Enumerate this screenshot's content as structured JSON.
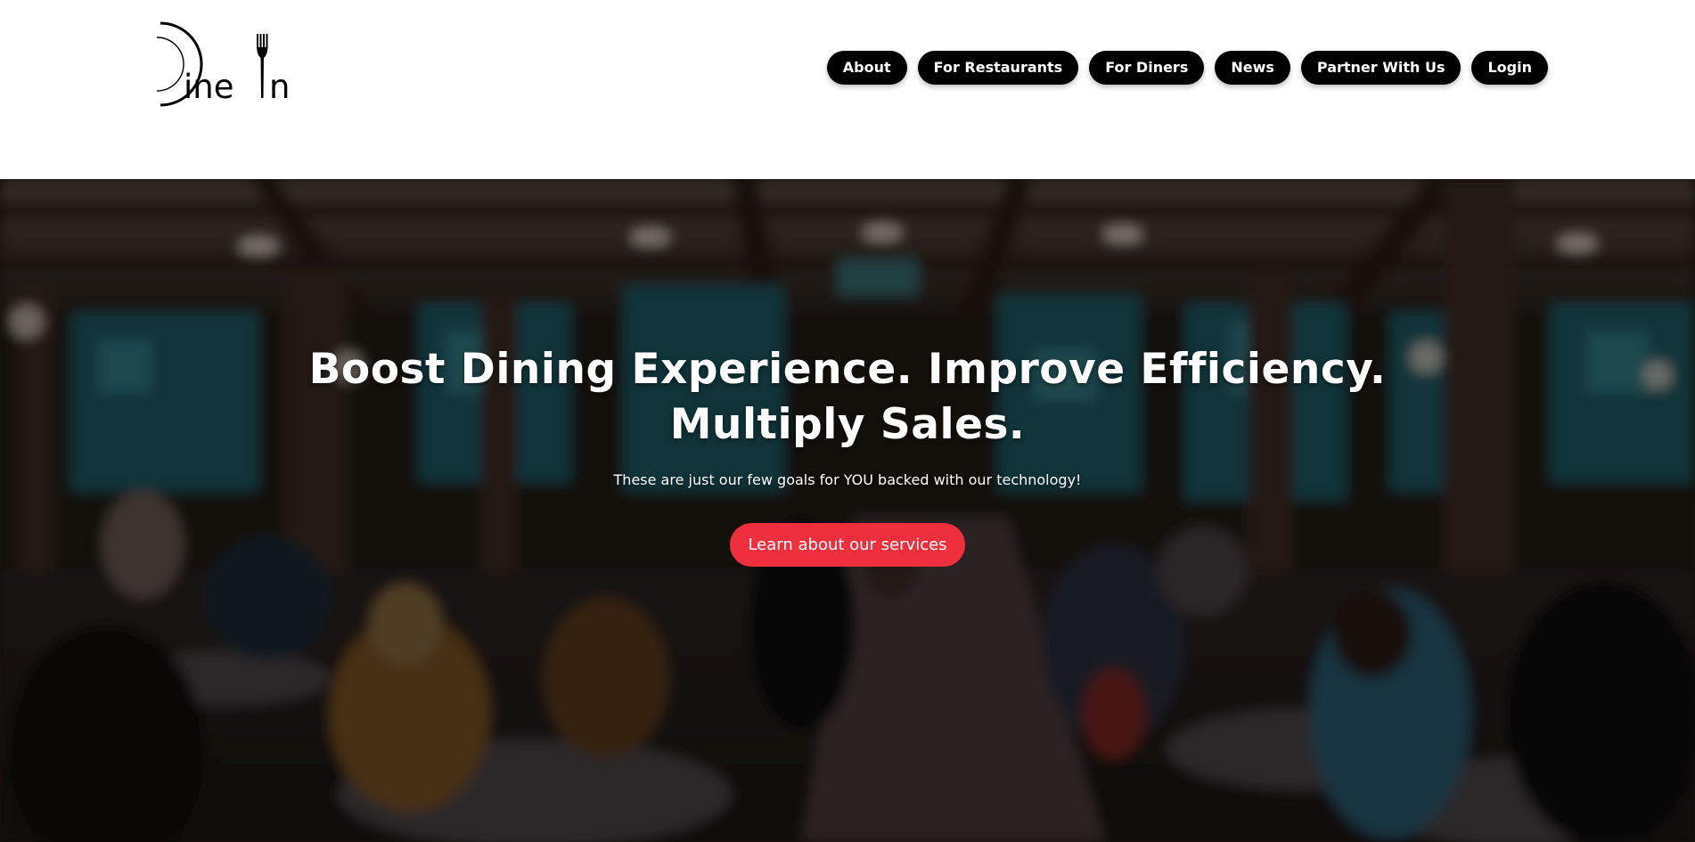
{
  "brand": {
    "logo_text": "Dine In",
    "logo_icon": "plate-fork-icon"
  },
  "nav": {
    "items": [
      {
        "label": "About"
      },
      {
        "label": "For Restaurants"
      },
      {
        "label": "For Diners"
      },
      {
        "label": "News"
      },
      {
        "label": "Partner With Us"
      },
      {
        "label": "Login"
      }
    ]
  },
  "hero": {
    "headline_line1": "Boost Dining Experience. Improve Efficiency.",
    "headline_line2": "Multiply Sales.",
    "subheadline": "These are just our few goals for YOU backed with our technology!",
    "cta_label": "Learn about our services",
    "background_image": "blurred-restaurant-interior"
  },
  "colors": {
    "nav_button_bg": "#000000",
    "cta_bg": "#ef2f3e",
    "text_light": "#ffffff"
  }
}
